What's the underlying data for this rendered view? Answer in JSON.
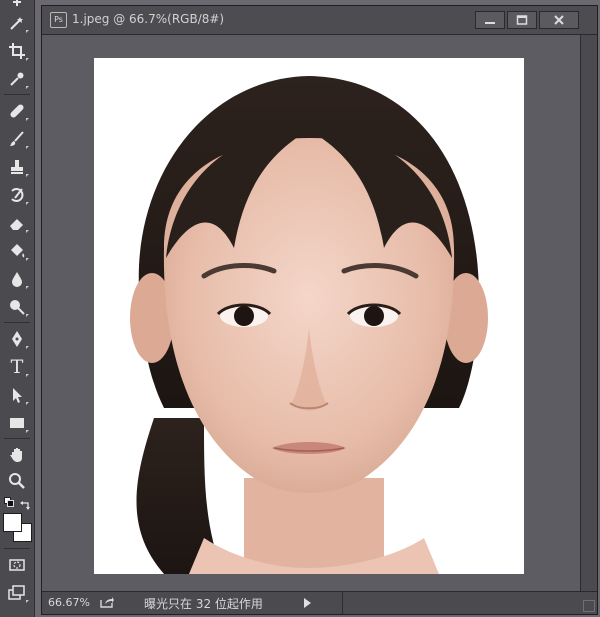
{
  "document": {
    "ps_badge": "Ps",
    "title": "1.jpeg @ 66.7%(RGB/8#)"
  },
  "status": {
    "zoom": "66.67%",
    "info": "曝光只在 32 位起作用"
  },
  "tools": [
    {
      "name": "magic-wand-icon"
    },
    {
      "name": "crop-icon"
    },
    {
      "name": "eyedropper-icon"
    },
    {
      "name": "healing-brush-icon"
    },
    {
      "name": "brush-icon"
    },
    {
      "name": "clone-stamp-icon"
    },
    {
      "name": "history-brush-icon"
    },
    {
      "name": "eraser-icon"
    },
    {
      "name": "paint-bucket-icon"
    },
    {
      "name": "blur-icon"
    },
    {
      "name": "dodge-icon"
    },
    {
      "name": "pen-icon"
    },
    {
      "name": "type-icon"
    },
    {
      "name": "path-selection-icon"
    },
    {
      "name": "rectangle-icon"
    },
    {
      "name": "hand-icon"
    },
    {
      "name": "zoom-icon"
    }
  ],
  "type_tool_glyph": "T",
  "colors": {
    "foreground": "#ffffff",
    "background": "#ffffff",
    "panel": "#4a4a4f",
    "canvas_bg": "#5e5c63"
  }
}
